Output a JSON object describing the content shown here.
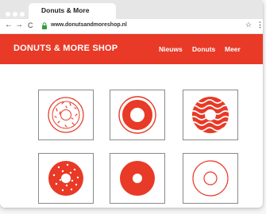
{
  "browser": {
    "tab_title": "Donuts & More",
    "url": "www.donutsandmoreshop.nl",
    "back_glyph": "←",
    "forward_glyph": "→",
    "reload_glyph": "C",
    "star_glyph": "☆",
    "menu_glyph": "⋮"
  },
  "site": {
    "logo": "DONUTS & MORE SHOP",
    "nav": [
      "Nieuws",
      "Donuts",
      "Meer"
    ]
  },
  "colors": {
    "brand_red": "#e83a27"
  },
  "products": [
    {
      "icon": "sprinkle-donut-outline-icon"
    },
    {
      "icon": "ring-donut-icon"
    },
    {
      "icon": "wavy-donut-icon"
    },
    {
      "icon": "dotted-donut-icon"
    },
    {
      "icon": "solid-donut-icon"
    },
    {
      "icon": "outline-donut-icon"
    }
  ]
}
